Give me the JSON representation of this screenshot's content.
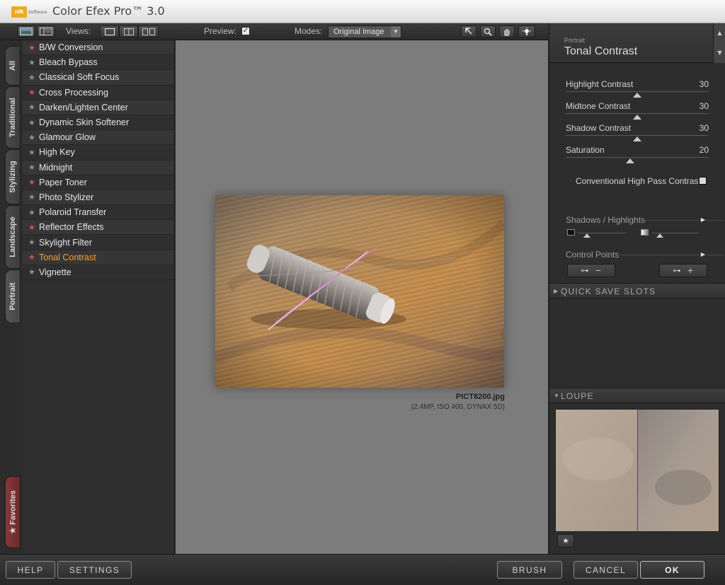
{
  "app": {
    "title": "Color Efex Pro™ 3.0",
    "logo_text": "nik",
    "logo_subtext": "Software"
  },
  "toolbar": {
    "views_label": "Views:",
    "preview_label": "Preview:",
    "preview_checked": true,
    "modes_label": "Modes:",
    "modes_value": "Original Image"
  },
  "tabs": [
    "All",
    "Traditional",
    "Stylizing",
    "Landscape",
    "Portrait",
    "Favorites"
  ],
  "filters": [
    {
      "name": "B/W Conversion",
      "favorite": true
    },
    {
      "name": "Bleach Bypass",
      "favorite": false
    },
    {
      "name": "Classical Soft Focus",
      "favorite": false
    },
    {
      "name": "Cross Processing",
      "favorite": true
    },
    {
      "name": "Darken/Lighten Center",
      "favorite": false
    },
    {
      "name": "Dynamic Skin Softener",
      "favorite": false
    },
    {
      "name": "Glamour Glow",
      "favorite": false
    },
    {
      "name": "High Key",
      "favorite": false
    },
    {
      "name": "Midnight",
      "favorite": false
    },
    {
      "name": "Paper Toner",
      "favorite": true
    },
    {
      "name": "Photo Stylizer",
      "favorite": false
    },
    {
      "name": "Polaroid Transfer",
      "favorite": false
    },
    {
      "name": "Reflector Effects",
      "favorite": true
    },
    {
      "name": "Skylight Filter",
      "favorite": false
    },
    {
      "name": "Tonal Contrast",
      "favorite": true,
      "active": true
    },
    {
      "name": "Vignette",
      "favorite": false
    }
  ],
  "preview": {
    "filename": "PICT8200.jpg",
    "meta": "(2.4MP, ISO 400, DYNAX 5D)"
  },
  "panel": {
    "category": "Portrait",
    "title": "Tonal Contrast",
    "sliders": [
      {
        "label": "Highlight Contrast",
        "value": 30,
        "level": 0.5
      },
      {
        "label": "Midtone Contrast",
        "value": 30,
        "level": 0.5
      },
      {
        "label": "Shadow Contrast",
        "value": 30,
        "level": 0.5
      },
      {
        "label": "Saturation",
        "value": 20,
        "level": 0.45
      }
    ],
    "checkbox_label": "Conventional High Pass Contrast",
    "checkbox_checked": false,
    "shadows_highlights": "Shadows / Highlights",
    "control_points": "Control Points",
    "quick_save": "QUICK SAVE SLOTS",
    "loupe": "LOUPE"
  },
  "buttons": {
    "help": "HELP",
    "settings": "SETTINGS",
    "brush": "BRUSH",
    "cancel": "CANCEL",
    "ok": "OK"
  },
  "colors": {
    "accent": "#f4a422",
    "favorite_star": "#d8504a",
    "loupe_divider": "#e01010"
  }
}
